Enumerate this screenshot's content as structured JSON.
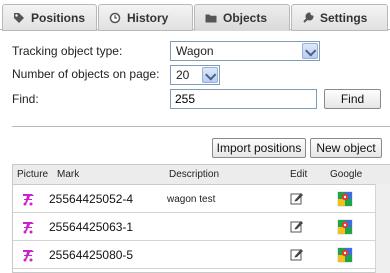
{
  "tabs": [
    {
      "label": "Positions",
      "icon": "tag-icon"
    },
    {
      "label": "History",
      "icon": "clock-icon"
    },
    {
      "label": "Objects",
      "icon": "folder-icon",
      "active": true
    },
    {
      "label": "Settings",
      "icon": "wrench-icon"
    }
  ],
  "form": {
    "tracking_type_label": "Tracking object type:",
    "tracking_type_value": "Wagon",
    "per_page_label": "Number of objects on page:",
    "per_page_value": "20",
    "find_label": "Find:",
    "find_value": "255",
    "find_button": "Find"
  },
  "actions": {
    "import_positions": "Import positions",
    "new_object": "New object"
  },
  "table": {
    "headers": {
      "picture": "Picture",
      "mark": "Mark",
      "description": "Description",
      "edit": "Edit",
      "google": "Google"
    },
    "rows": [
      {
        "mark": "25564425052-4",
        "description": "wagon test"
      },
      {
        "mark": "25564425063-1",
        "description": ""
      },
      {
        "mark": "25564425080-5",
        "description": ""
      }
    ]
  },
  "colors": {
    "wagon_icon": "#cc22cc",
    "google_green": "#1ea44a",
    "google_red": "#e03b2c",
    "google_blue": "#3a6fe0",
    "google_yellow": "#f3c01b"
  }
}
